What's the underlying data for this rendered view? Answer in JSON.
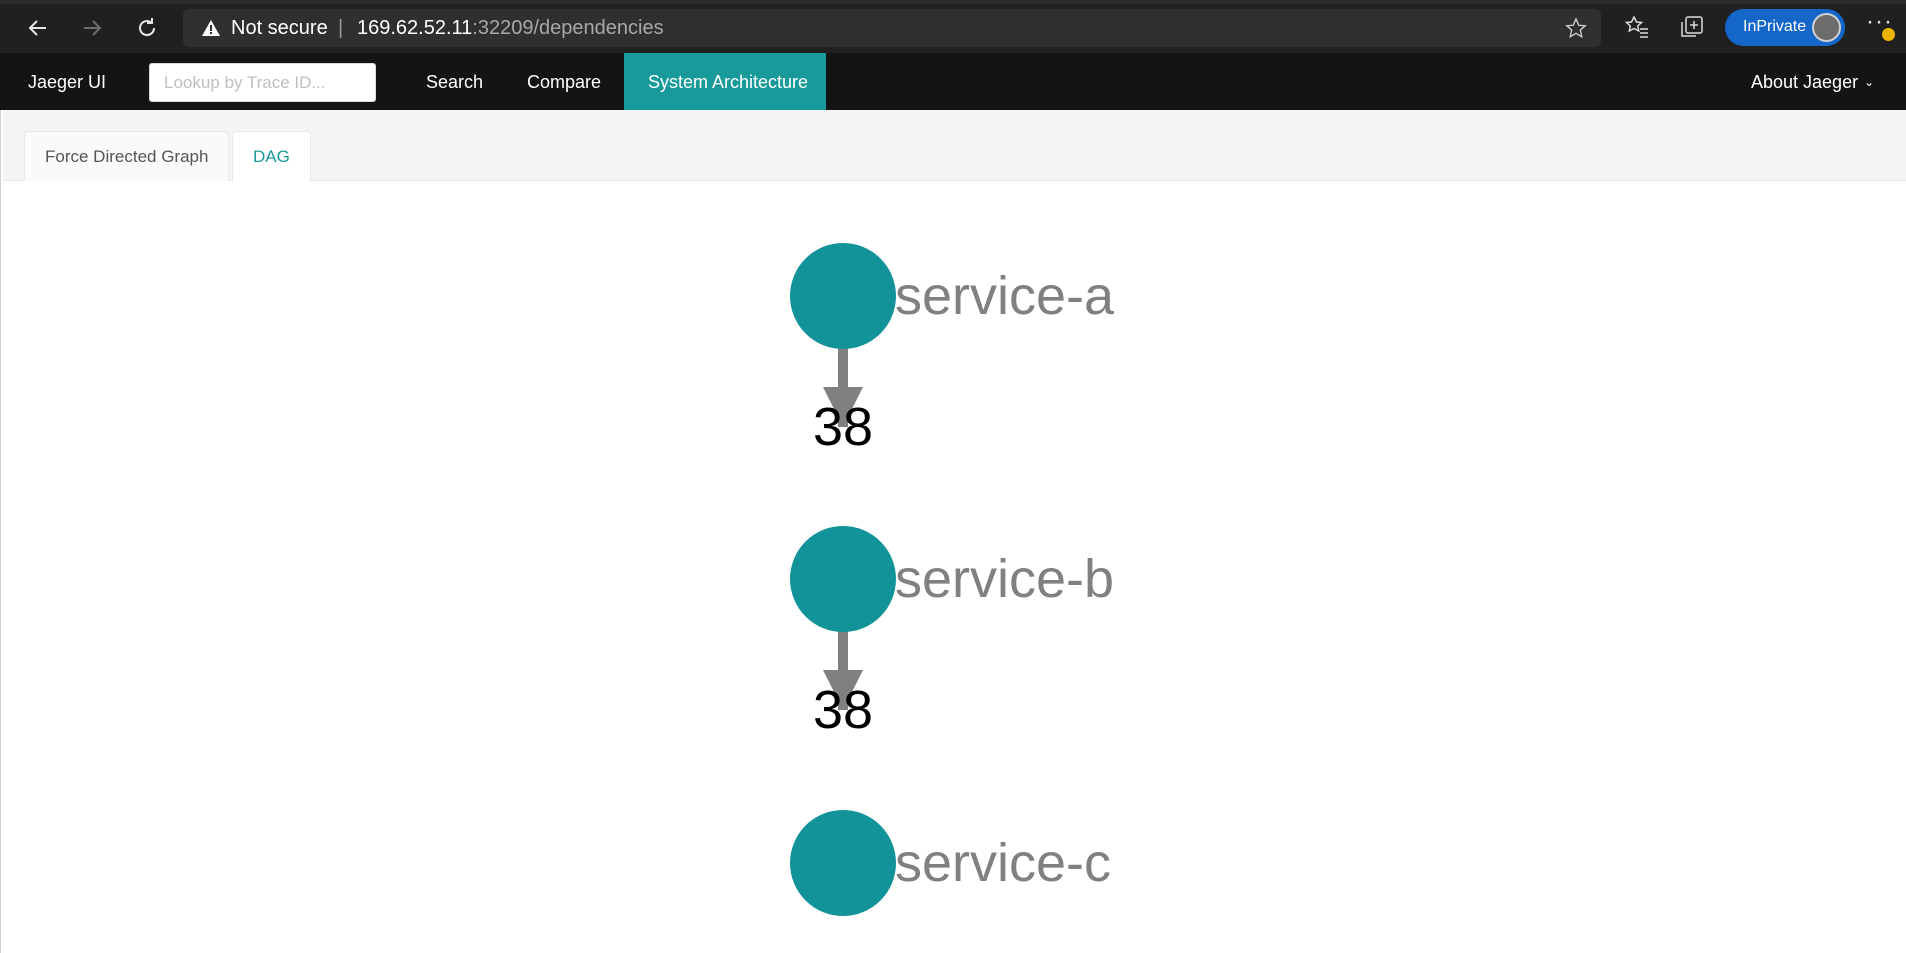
{
  "browser": {
    "security_label": "Not secure",
    "url_host": "169.62.52.11",
    "url_path": ":32209/dependencies",
    "inprivate_label": "InPrivate",
    "icons": [
      "back-icon",
      "forward-icon",
      "refresh-icon",
      "warning-icon",
      "star-icon",
      "favorites-icon",
      "collections-icon",
      "more-icon"
    ]
  },
  "nav": {
    "brand": "Jaeger UI",
    "search_placeholder": "Lookup by Trace ID...",
    "links": [
      "Search",
      "Compare",
      "System Architecture"
    ],
    "active": "System Architecture",
    "about": "About Jaeger"
  },
  "tabs": [
    {
      "label": "Force Directed Graph",
      "active": false
    },
    {
      "label": "DAG",
      "active": true
    }
  ],
  "colors": {
    "accent": "#199a9a",
    "node": "#12939a",
    "edge": "#808080",
    "node_label": "#808080",
    "edge_label": "#000000"
  },
  "graph": {
    "nodes": [
      "service-a",
      "service-b",
      "service-c"
    ],
    "edges": [
      {
        "from": "service-a",
        "to": "service-b",
        "call_count": "38"
      },
      {
        "from": "service-b",
        "to": "service-c",
        "call_count": "38"
      }
    ]
  }
}
